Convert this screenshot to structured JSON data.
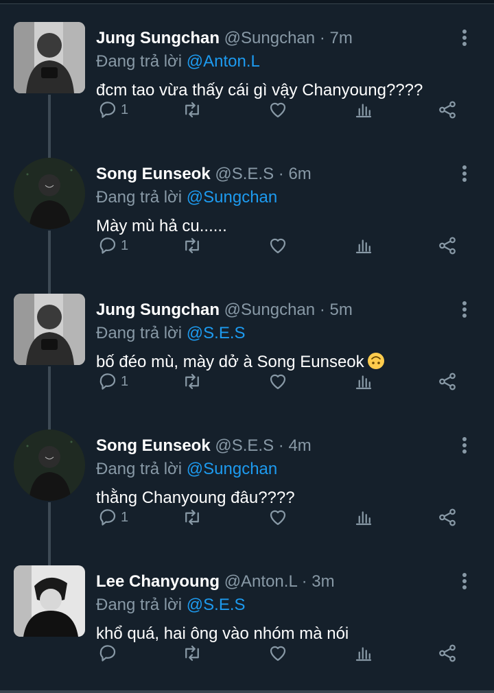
{
  "tweets": [
    {
      "name": "Jung Sungchan",
      "handle": "@Sungchan",
      "separator": "·",
      "time": "7m",
      "reply_prefix": "Đang trả lời",
      "reply_to": "@Anton.L",
      "text": "đcm tao vừa thấy cái gì vậy Chanyoung????",
      "reply_count": "1",
      "emoji": ""
    },
    {
      "name": "Song Eunseok",
      "handle": "@S.E.S",
      "separator": "·",
      "time": "6m",
      "reply_prefix": "Đang trả lời",
      "reply_to": "@Sungchan",
      "text": "Mày mù hả cu......",
      "reply_count": "1",
      "emoji": ""
    },
    {
      "name": "Jung Sungchan",
      "handle": "@Sungchan",
      "separator": "·",
      "time": "5m",
      "reply_prefix": "Đang trả lời",
      "reply_to": "@S.E.S",
      "text": "bố đéo mù, mày dở à Song Eunseok",
      "reply_count": "1",
      "emoji": "upside-down-face"
    },
    {
      "name": "Song Eunseok",
      "handle": "@S.E.S",
      "separator": "·",
      "time": "4m",
      "reply_prefix": "Đang trả lời",
      "reply_to": "@Sungchan",
      "text": "thằng Chanyoung đâu????",
      "reply_count": "1",
      "emoji": ""
    },
    {
      "name": "Lee Chanyoung",
      "handle": "@Anton.L",
      "separator": "·",
      "time": "3m",
      "reply_prefix": "Đang trả lời",
      "reply_to": "@S.E.S",
      "text": "khổ quá, hai ông vào nhóm mà nói",
      "reply_count": "",
      "emoji": ""
    }
  ],
  "colors": {
    "background": "#15202b",
    "secondary_text": "#8899a6",
    "mention": "#1d9bf0",
    "thread_line": "#3d4a55"
  },
  "icons": [
    "reply-icon",
    "retweet-icon",
    "like-icon",
    "analytics-icon",
    "share-icon",
    "more-icon"
  ]
}
